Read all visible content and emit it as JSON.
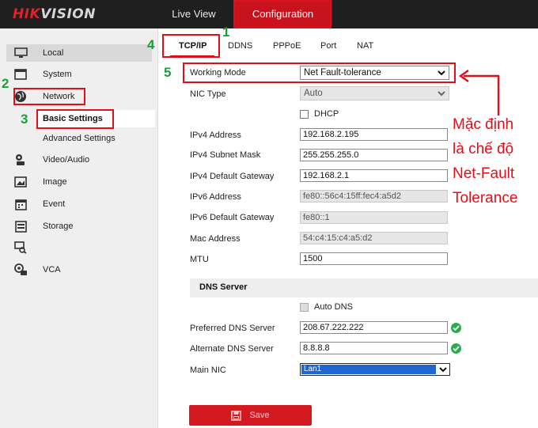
{
  "brand": {
    "part1": "HIK",
    "part2": "VISION"
  },
  "top_nav": {
    "live_view": "Live View",
    "configuration": "Configuration"
  },
  "sidebar": {
    "local": "Local",
    "system": "System",
    "network": "Network",
    "basic_settings": "Basic Settings",
    "advanced_settings": "Advanced Settings",
    "video_audio": "Video/Audio",
    "image": "Image",
    "event": "Event",
    "storage": "Storage",
    "vca": "VCA"
  },
  "tabs": [
    "TCP/IP",
    "DDNS",
    "PPPoE",
    "Port",
    "NAT"
  ],
  "form": {
    "working_mode": {
      "label": "Working Mode",
      "value": "Net Fault-tolerance"
    },
    "nic_type": {
      "label": "NIC Type",
      "value": "Auto"
    },
    "dhcp": {
      "label": "DHCP",
      "checked": false
    },
    "ipv4_address": {
      "label": "IPv4 Address",
      "value": "192.168.2.195"
    },
    "ipv4_mask": {
      "label": "IPv4 Subnet Mask",
      "value": "255.255.255.0"
    },
    "ipv4_gateway": {
      "label": "IPv4 Default Gateway",
      "value": "192.168.2.1"
    },
    "ipv6_address": {
      "label": "IPv6 Address",
      "value": "fe80::56c4:15ff:fec4:a5d2"
    },
    "ipv6_gateway": {
      "label": "IPv6 Default Gateway",
      "value": "fe80::1"
    },
    "mac_address": {
      "label": "Mac Address",
      "value": "54:c4:15:c4:a5:d2"
    },
    "mtu": {
      "label": "MTU",
      "value": "1500"
    }
  },
  "dns": {
    "section_title": "DNS Server",
    "auto_dns": {
      "label": "Auto DNS",
      "checked": false
    },
    "preferred": {
      "label": "Preferred DNS Server",
      "value": "208.67.222.222"
    },
    "alternate": {
      "label": "Alternate DNS Server",
      "value": "8.8.8.8"
    },
    "main_nic": {
      "label": "Main NIC",
      "value": "Lan1"
    }
  },
  "save_label": "Save",
  "annotations": {
    "n1": "1",
    "n2": "2",
    "n3": "3",
    "n4": "4",
    "n5": "5",
    "note_lines": [
      "Mặc định",
      "là chế độ",
      "Net-Fault",
      "Tolerance"
    ]
  },
  "colors": {
    "accent": "#c8131e",
    "annotation_red": "#e0101a",
    "annotation_green": "#1a9e3a",
    "ok_green": "#2da94f",
    "selection_blue": "#1e66d0"
  },
  "icons": {
    "local": "monitor-icon",
    "system": "system-window-icon",
    "network": "globe-icon",
    "video_audio": "video-audio-icon",
    "image": "image-icon",
    "event": "calendar-icon",
    "storage": "storage-icon",
    "extra": "search-camera-icon",
    "vca": "vca-icon",
    "save": "floppy-disk-icon",
    "status": "check-circle-icon"
  }
}
